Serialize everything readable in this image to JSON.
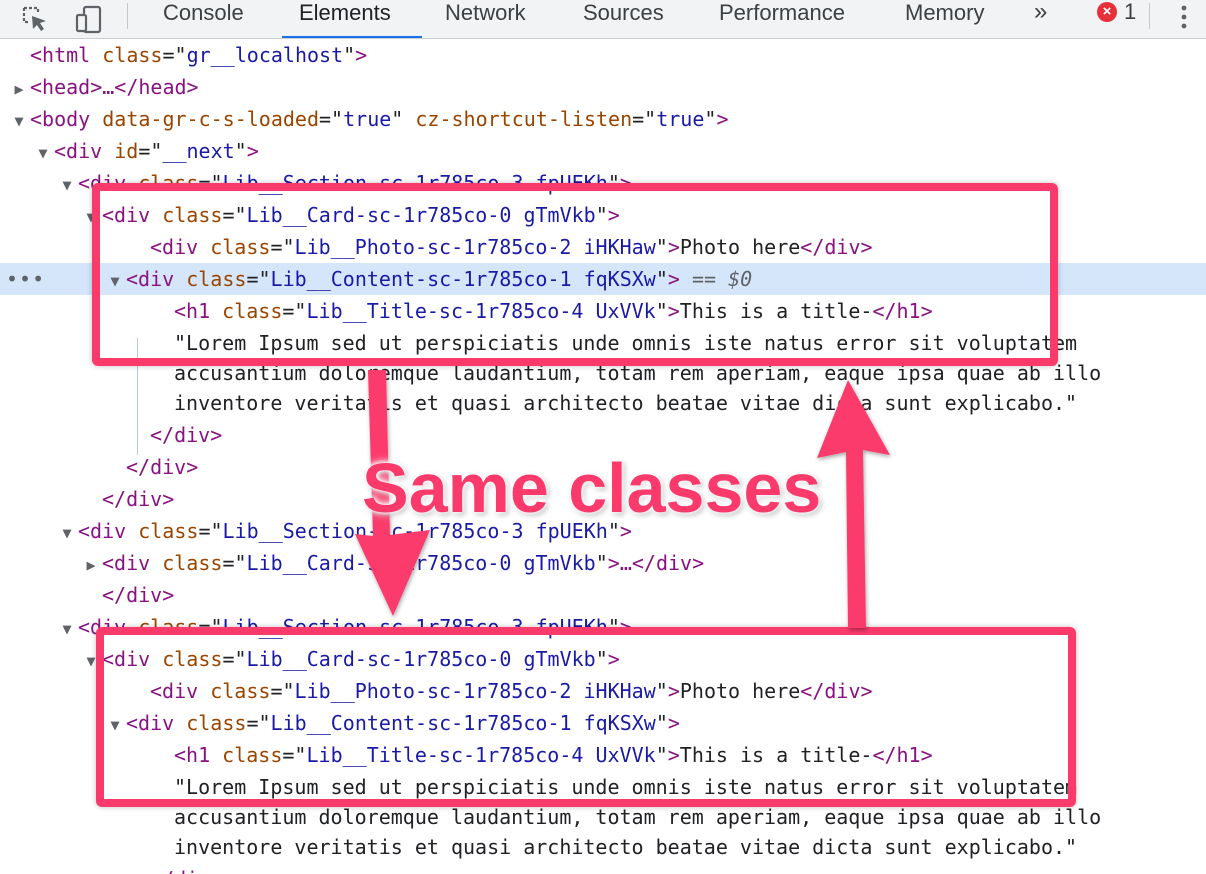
{
  "toolbar": {
    "tabs": [
      {
        "label": "Console"
      },
      {
        "label": "Elements"
      },
      {
        "label": "Network"
      },
      {
        "label": "Sources"
      },
      {
        "label": "Performance"
      },
      {
        "label": "Memory"
      }
    ],
    "more_tabs": "»",
    "error_count": "1",
    "active_tab": "Elements"
  },
  "tree": {
    "lines": [
      {
        "tag": "<html",
        "attrs": [
          {
            "name": "class",
            "value": "gr__localhost"
          }
        ],
        "close": ">"
      },
      {
        "tag": "<head",
        "close": ">…</head>"
      },
      {
        "tag": "<body",
        "attrs": [
          {
            "name": "data-gr-c-s-loaded",
            "value": "true"
          },
          {
            "name": "cz-shortcut-listen",
            "value": "true"
          }
        ],
        "close": ">"
      },
      {
        "tag": "<div",
        "attrs": [
          {
            "name": "id",
            "value": "__next"
          }
        ],
        "close": ">"
      },
      {
        "tag": "<div",
        "attrs": [
          {
            "name": "class",
            "value": "Lib__Section-sc-1r785co-3 fpUEKh"
          }
        ],
        "close": ">"
      },
      {
        "tag": "<div",
        "attrs": [
          {
            "name": "class",
            "value": "Lib__Card-sc-1r785co-0 gTmVkb"
          }
        ],
        "close": ">"
      },
      {
        "tag": "<div",
        "attrs": [
          {
            "name": "class",
            "value": "Lib__Photo-sc-1r785co-2 iHKHaw"
          }
        ],
        "close": ">",
        "text": "Photo here",
        "end": "</div>"
      },
      {
        "tag": "<div",
        "attrs": [
          {
            "name": "class",
            "value": "Lib__Content-sc-1r785co-1 fqKSXw"
          }
        ],
        "close": ">",
        "suffix": " == $0"
      },
      {
        "tag": "<h1",
        "attrs": [
          {
            "name": "class",
            "value": "Lib__Title-sc-1r785co-4 UxVVk"
          }
        ],
        "close": ">",
        "text": "This is a title-",
        "end": "</h1>"
      },
      {
        "text": "\"Lorem Ipsum sed ut perspiciatis unde omnis iste natus error sit voluptatem"
      },
      {
        "text": "accusantium doloremque laudantium, totam rem aperiam, eaque ipsa quae ab illo"
      },
      {
        "text": "inventore veritatis et quasi architecto beatae vitae dicta sunt explicabo.\""
      },
      {
        "end": "</div>"
      },
      {
        "end": "</div>"
      },
      {
        "end": "</div>"
      },
      {
        "tag": "<div",
        "attrs": [
          {
            "name": "class",
            "value": "Lib__Section-sc-1r785co-3 fpUEKh"
          }
        ],
        "close": ">"
      },
      {
        "tag": "<div",
        "attrs": [
          {
            "name": "class",
            "value": "Lib__Card-sc-1r785co-0 gTmVkb"
          }
        ],
        "close": ">…</div>"
      },
      {
        "end": "</div>"
      },
      {
        "tag": "<div",
        "attrs": [
          {
            "name": "class",
            "value": "Lib__Section-sc-1r785co-3 fpUEKh"
          }
        ],
        "close": ">"
      },
      {
        "tag": "<div",
        "attrs": [
          {
            "name": "class",
            "value": "Lib__Card-sc-1r785co-0 gTmVkb"
          }
        ],
        "close": ">"
      },
      {
        "tag": "<div",
        "attrs": [
          {
            "name": "class",
            "value": "Lib__Photo-sc-1r785co-2 iHKHaw"
          }
        ],
        "close": ">",
        "text": "Photo here",
        "end": "</div>"
      },
      {
        "tag": "<div",
        "attrs": [
          {
            "name": "class",
            "value": "Lib__Content-sc-1r785co-1 fqKSXw"
          }
        ],
        "close": ">"
      },
      {
        "tag": "<h1",
        "attrs": [
          {
            "name": "class",
            "value": "Lib__Title-sc-1r785co-4 UxVVk"
          }
        ],
        "close": ">",
        "text": "This is a title-",
        "end": "</h1>"
      },
      {
        "text": "\"Lorem Ipsum sed ut perspiciatis unde omnis iste natus error sit voluptatem"
      },
      {
        "text": "accusantium doloremque laudantium, totam rem aperiam, eaque ipsa quae ab illo"
      },
      {
        "text": "inventore veritatis et quasi architecto beatae vitae dicta sunt explicabo.\""
      },
      {
        "end": "</div>"
      }
    ]
  },
  "annotation": {
    "callout": "Same classes",
    "color": "#fb3a6c"
  },
  "colors": {
    "tag": "#881280",
    "attr_name": "#994500",
    "attr_value": "#1a1aa6",
    "selection": "#d5e6fb",
    "active_tab": "#1a73e8"
  },
  "icons": {
    "inspect": "inspect-element-icon",
    "device": "device-toolbar-icon",
    "error": "error-icon",
    "menu": "kebab-menu-icon"
  }
}
